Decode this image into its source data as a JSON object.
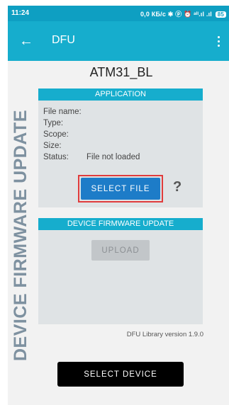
{
  "status_bar": {
    "time": "11:24",
    "indicators": "0,0 КБ/с ✱ ⓟ ⏰ ᵃⁱˡ.ıl .ıl",
    "battery": "85"
  },
  "app_bar": {
    "back_icon": "arrow-left-icon",
    "title": "DFU",
    "menu_icon": "more-vertical-icon"
  },
  "side_title": "DEVICE FIRMWARE UPDATE",
  "device_name": "ATM31_BL",
  "application_panel": {
    "header": "APPLICATION",
    "fields": [
      {
        "label": "File name:",
        "value": ""
      },
      {
        "label": "Type:",
        "value": ""
      },
      {
        "label": "Scope:",
        "value": ""
      },
      {
        "label": "Size:",
        "value": ""
      },
      {
        "label": "Status:",
        "value": "File not loaded"
      }
    ],
    "select_file_label": "SELECT FILE",
    "help_label": "?"
  },
  "dfu_panel": {
    "header": "DEVICE FIRMWARE UPDATE",
    "upload_label": "UPLOAD"
  },
  "library_version": "DFU Library version 1.9.0",
  "select_device_label": "SELECT DEVICE",
  "colors": {
    "status_bar": "#0e9fc2",
    "app_bar": "#16adcd",
    "primary_button": "#1d7cc8",
    "highlight": "#e03c3c"
  }
}
